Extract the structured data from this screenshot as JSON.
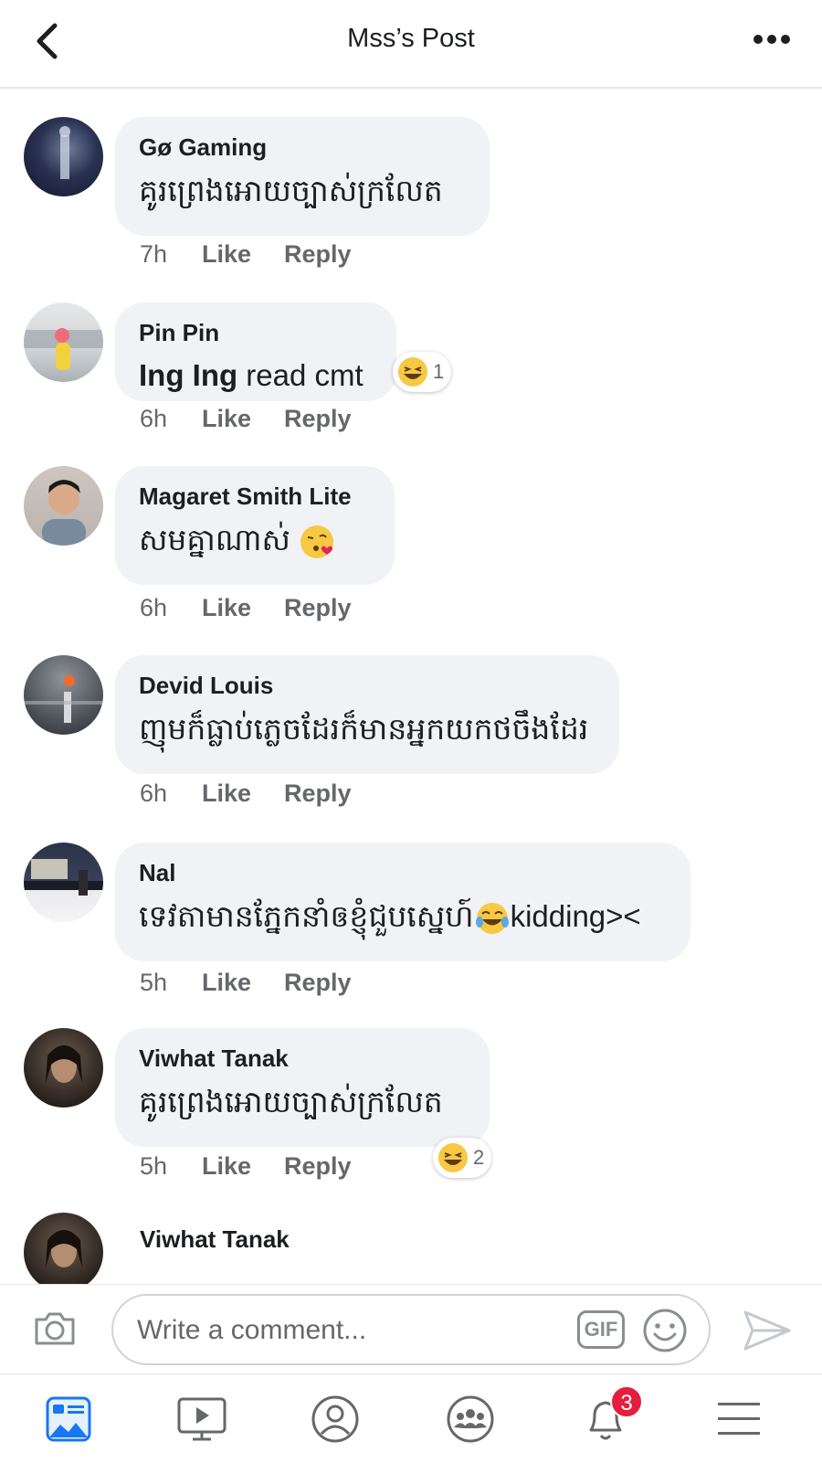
{
  "header": {
    "title": "Mss’s Post"
  },
  "comments": [
    {
      "author": "Gø Gaming",
      "text": "គូរព្រេងអោយច្បាស់ក្រលែត",
      "time": "7h",
      "like": "Like",
      "reply": "Reply"
    },
    {
      "author": "Pin Pin",
      "tag": "Ing Ing",
      "text": " read cmt",
      "time": "6h",
      "like": "Like",
      "reply": "Reply",
      "reaction_count": "1"
    },
    {
      "author": "Magaret Smith Lite",
      "text": "សមគ្នាណាស់ ",
      "time": "6h",
      "like": "Like",
      "reply": "Reply"
    },
    {
      "author": "Devid Louis",
      "text": "ញុមក៏ធ្លាប់ភ្លេចដែរក៏មានអ្នកយកថចឹងដែរ",
      "time": "6h",
      "like": "Like",
      "reply": "Reply"
    },
    {
      "author": "Nal",
      "text": "ទេវតាមានភ្នែកនាំឲខ្ញុំជួបស្នេហ៍",
      "text_tail": "kidding><",
      "time": "5h",
      "like": "Like",
      "reply": "Reply"
    },
    {
      "author": "Viwhat Tanak",
      "text": "គូរព្រេងអោយច្បាស់ក្រលែត",
      "time": "5h",
      "like": "Like",
      "reply": "Reply",
      "reaction_count": "2"
    },
    {
      "author": "Viwhat Tanak"
    }
  ],
  "composer": {
    "placeholder": "Write a comment...",
    "gif_label": "GIF"
  },
  "nav": {
    "notifications_badge": "3"
  },
  "icons": [
    "back-icon",
    "more-icon",
    "camera-icon",
    "emoji-icon",
    "send-icon",
    "news-feed-icon",
    "watch-icon",
    "profile-icon",
    "groups-icon",
    "bell-icon",
    "menu-icon"
  ],
  "colors": {
    "accent": "#1877f2",
    "bubble": "#f0f2f5",
    "badge": "#e41e3f"
  }
}
